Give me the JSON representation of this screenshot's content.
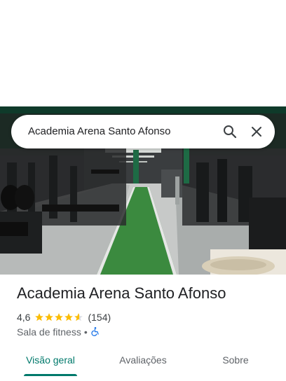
{
  "search": {
    "query": "Academia Arena Santo Afonso",
    "search_icon": "search-icon",
    "close_icon": "close-icon"
  },
  "hero_image": {
    "description_icon": "gym-photo"
  },
  "place": {
    "title": "Academia Arena Santo Afonso",
    "rating": "4,6",
    "rating_value": 4.6,
    "stars_max": 5,
    "review_count": "(154)",
    "category": "Sala de fitness",
    "separator": "•",
    "accessibility_icon": "wheelchair-icon"
  },
  "tabs": [
    {
      "label": "Visão geral",
      "active": true
    },
    {
      "label": "Avaliações",
      "active": false
    },
    {
      "label": "Sobre",
      "active": false
    }
  ],
  "colors": {
    "accent": "#00796b",
    "star": "#fbbc04",
    "accessibility": "#1a73e8"
  }
}
